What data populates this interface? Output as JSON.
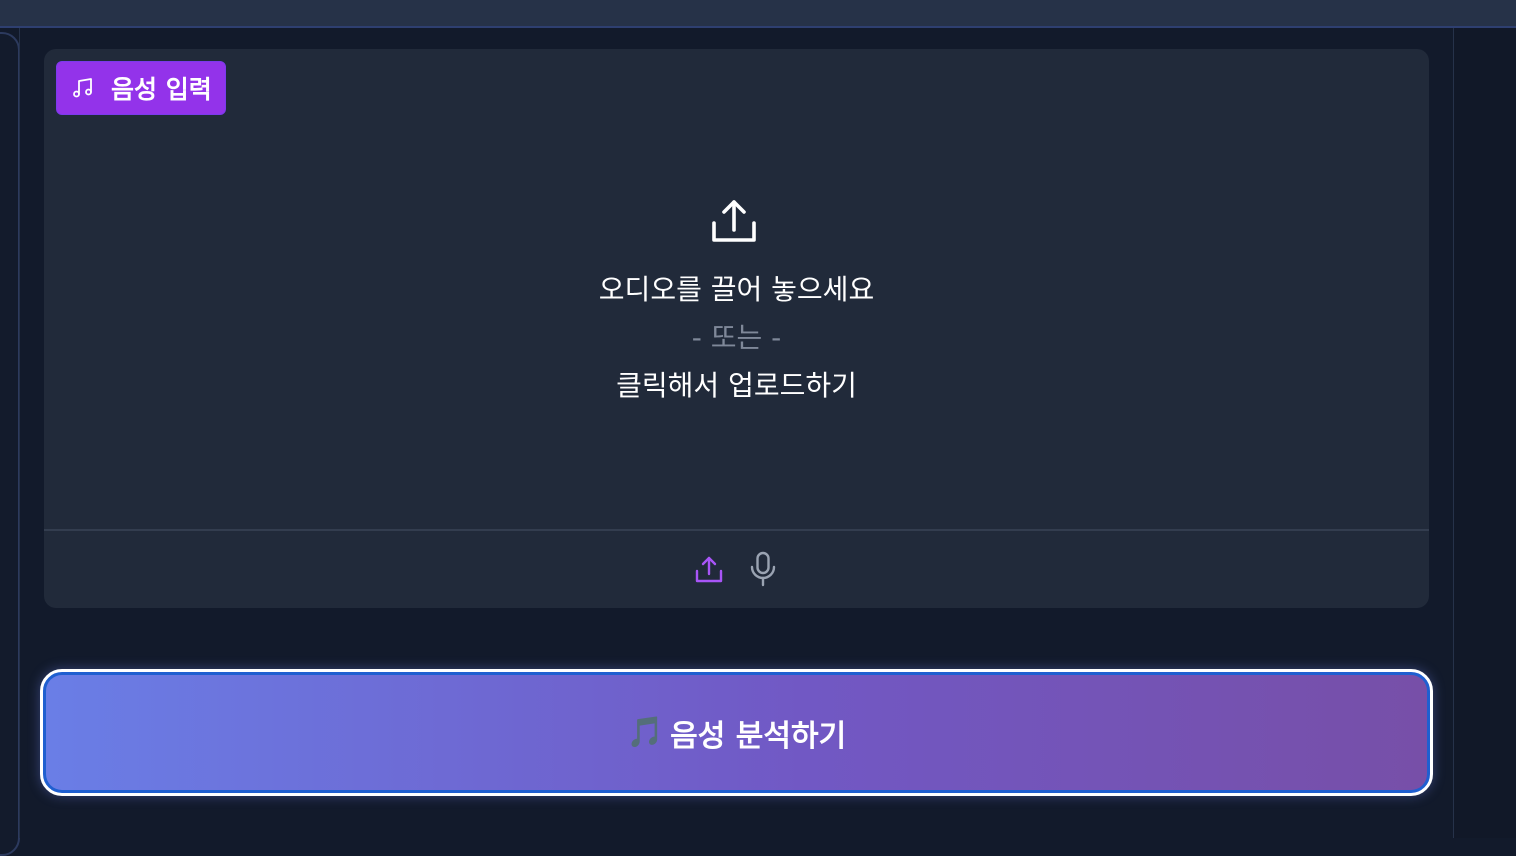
{
  "audio_input": {
    "badge_label": "음성 입력",
    "badge_icon": "music-note-icon",
    "dropzone": {
      "icon": "upload-icon",
      "line1": "오디오를 끌어 놓으세요",
      "line2": "- 또는 -",
      "line3": "클릭해서 업로드하기"
    },
    "sources": [
      {
        "name": "upload-source",
        "icon": "upload-icon",
        "active": true
      },
      {
        "name": "microphone-source",
        "icon": "microphone-icon",
        "active": false
      }
    ]
  },
  "analyze_button": {
    "emoji": "🎵",
    "label": "음성 분석하기"
  },
  "colors": {
    "accent": "#9333ea",
    "card_bg": "#212a3a",
    "page_bg": "#121a2b",
    "button_gradient_start": "#6a7ee6",
    "button_gradient_end": "#774fa8",
    "button_border": "#1f5fd0"
  }
}
